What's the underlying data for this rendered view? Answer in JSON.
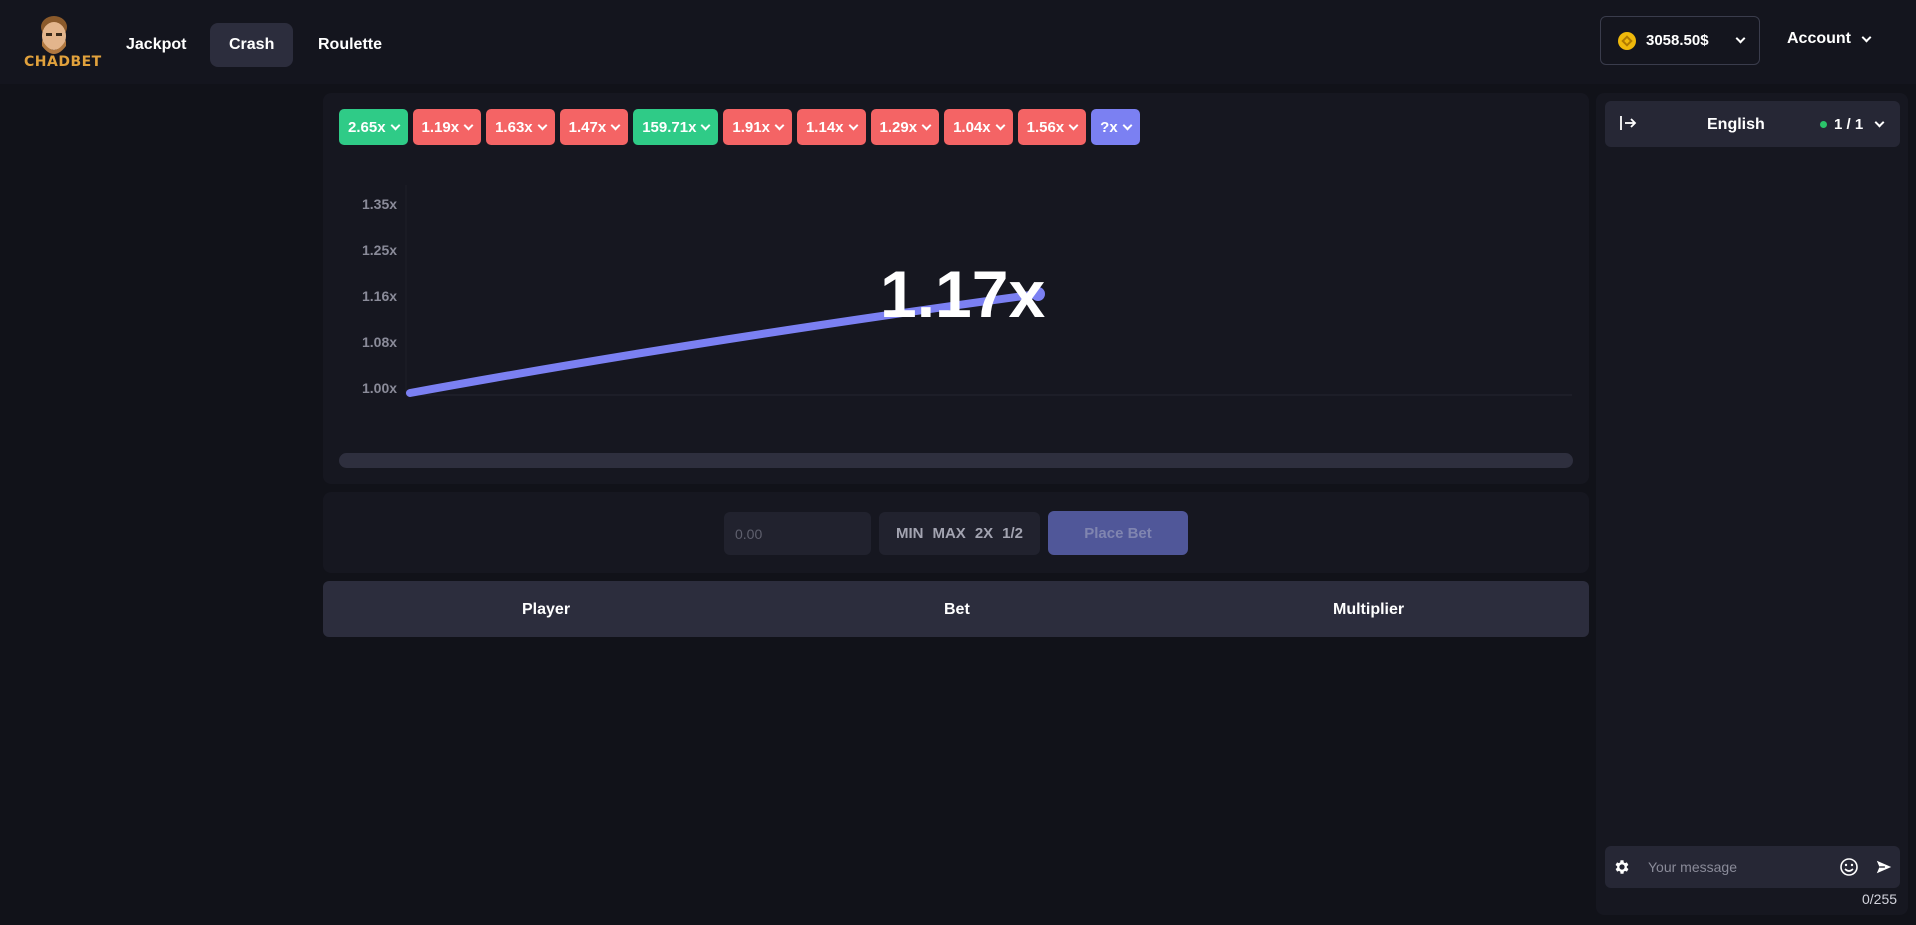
{
  "brand": {
    "name": "CHADBET"
  },
  "nav": [
    {
      "label": "Jackpot",
      "active": false
    },
    {
      "label": "Crash",
      "active": true
    },
    {
      "label": "Roulette",
      "active": false
    }
  ],
  "balance": {
    "amount": "3058.50$",
    "icon": "coin-icon"
  },
  "account": {
    "label": "Account"
  },
  "history": [
    {
      "label": "2.65x",
      "color": "green"
    },
    {
      "label": "1.19x",
      "color": "red"
    },
    {
      "label": "1.63x",
      "color": "red"
    },
    {
      "label": "1.47x",
      "color": "red"
    },
    {
      "label": "159.71x",
      "color": "green"
    },
    {
      "label": "1.91x",
      "color": "red"
    },
    {
      "label": "1.14x",
      "color": "red"
    },
    {
      "label": "1.29x",
      "color": "red"
    },
    {
      "label": "1.04x",
      "color": "red"
    },
    {
      "label": "1.56x",
      "color": "red"
    },
    {
      "label": "?x",
      "color": "blue"
    }
  ],
  "colors": {
    "green": "#2fcb87",
    "red": "#f46465",
    "blue": "#7b80f2",
    "accent": "#7b80f2",
    "online": "#2bc46a"
  },
  "game": {
    "current_multiplier": "1.17x",
    "y_ticks": [
      "1.35x",
      "1.25x",
      "1.16x",
      "1.08x",
      "1.00x"
    ]
  },
  "bet": {
    "amount_placeholder": "0.00",
    "quick": [
      "MIN",
      "MAX",
      "2X",
      "1/2"
    ],
    "place_label": "Place Bet"
  },
  "table": {
    "columns": [
      "Player",
      "Bet",
      "Multiplier"
    ]
  },
  "chat": {
    "language": "English",
    "online": "1 / 1",
    "message_placeholder": "Your message",
    "counter": "0/255"
  }
}
